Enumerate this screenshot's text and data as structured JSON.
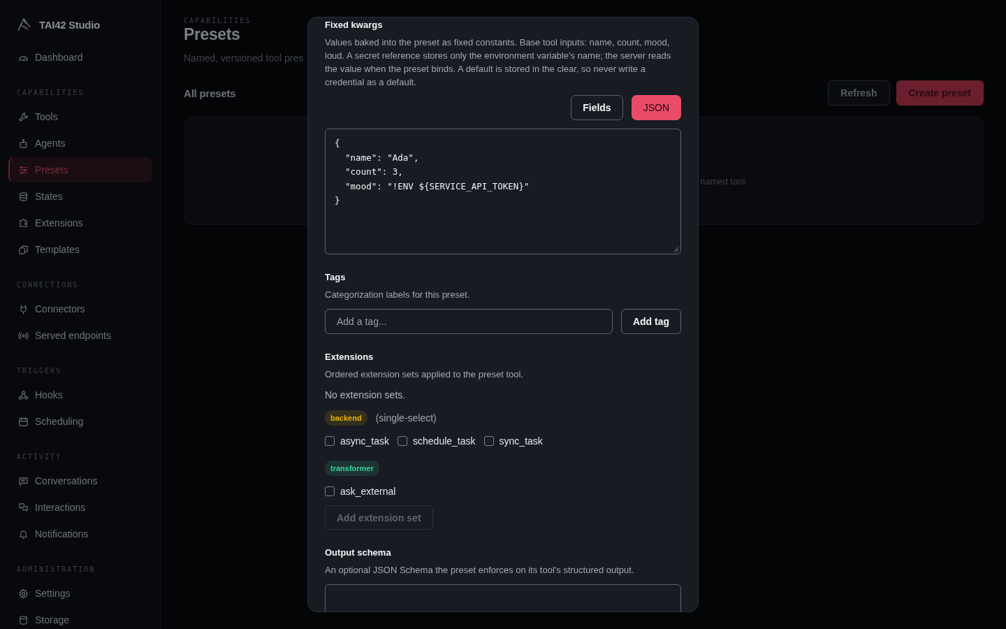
{
  "sidebar": {
    "brand": "TAI42 Studio",
    "groups": [
      {
        "items": [
          {
            "label": "Dashboard",
            "selected": false
          }
        ]
      },
      {
        "label": "CAPABILITIES",
        "items": [
          {
            "label": "Tools",
            "selected": false
          },
          {
            "label": "Agents",
            "selected": false
          },
          {
            "label": "Presets",
            "selected": true
          },
          {
            "label": "States",
            "selected": false
          },
          {
            "label": "Extensions",
            "selected": false
          },
          {
            "label": "Templates",
            "selected": false
          }
        ]
      },
      {
        "label": "CONNECTIONS",
        "items": [
          {
            "label": "Connectors",
            "selected": false
          },
          {
            "label": "Served endpoints",
            "selected": false
          }
        ]
      },
      {
        "label": "TRIGGERS",
        "items": [
          {
            "label": "Hooks",
            "selected": false
          },
          {
            "label": "Scheduling",
            "selected": false
          }
        ]
      },
      {
        "label": "ACTIVITY",
        "items": [
          {
            "label": "Conversations",
            "selected": false
          },
          {
            "label": "Interactions",
            "selected": false
          },
          {
            "label": "Notifications",
            "selected": false
          }
        ]
      },
      {
        "label": "ADMINISTRATION",
        "items": [
          {
            "label": "Settings",
            "selected": false
          },
          {
            "label": "Storage",
            "selected": false
          }
        ]
      }
    ]
  },
  "page": {
    "eyebrow": "CAPABILITIES",
    "title": "Presets",
    "subtitle": "Named, versioned tool pres",
    "section_title": "All presets",
    "buttons": [
      {
        "label": "Refresh",
        "kind": "secondary"
      },
      {
        "label": "Create preset",
        "kind": "primary"
      }
    ],
    "empty_text": "named tool."
  },
  "modal": {
    "fixed_kwargs": {
      "title": "Fixed kwargs",
      "description": "Values baked into the preset as fixed constants. Base tool inputs: name, count, mood, loud. A secret reference stores only the environment variable's name; the server reads the value when the preset binds. A default is stored in the clear, so never write a credential as a default.",
      "modes": [
        {
          "label": "Fields",
          "selected": false
        },
        {
          "label": "JSON",
          "selected": true
        }
      ],
      "value": "{\n  \"name\": \"Ada\",\n  \"count\": 3,\n  \"mood\": \"!ENV ${SERVICE_API_TOKEN}\"\n}"
    },
    "tags": {
      "title": "Tags",
      "description": "Categorization labels for this preset.",
      "placeholder": "Add a tag...",
      "button": "Add tag"
    },
    "extensions": {
      "title": "Extensions",
      "description": "Ordered extension sets applied to the preset tool.",
      "empty": "No extension sets.",
      "sets": [
        {
          "tag": "backend",
          "color": "#eab308",
          "note": "(single-select)",
          "options": [
            {
              "label": "async_task",
              "checked": false
            },
            {
              "label": "schedule_task",
              "checked": false
            },
            {
              "label": "sync_task",
              "checked": false
            }
          ]
        },
        {
          "tag": "transformer",
          "color": "#34d399",
          "options": [
            {
              "label": "ask_external",
              "checked": false
            }
          ]
        }
      ],
      "add_button": {
        "label": "Add extension set",
        "disabled": true
      }
    },
    "output_schema": {
      "title": "Output schema",
      "description": "An optional JSON Schema the preset enforces on its tool's structured output."
    }
  }
}
